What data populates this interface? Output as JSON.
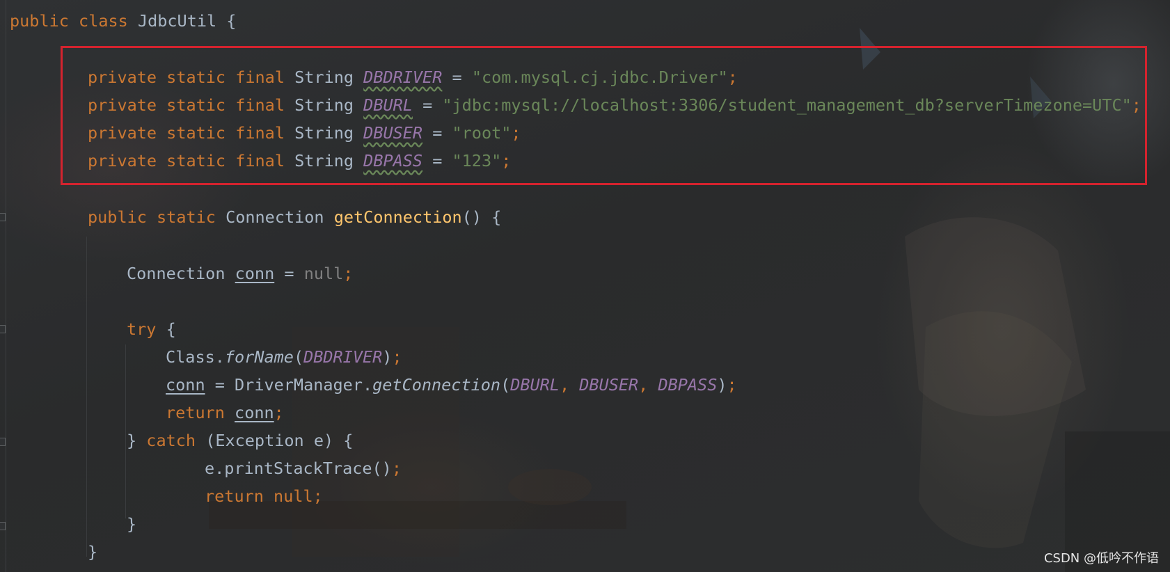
{
  "code": {
    "class_decl": {
      "kw_public": "public",
      "kw_class": "class",
      "name": "JdbcUtil",
      "brace": " {"
    },
    "fields": [
      {
        "mods": "private static final",
        "type": "String",
        "name": "DBDRIVER",
        "eq": " = ",
        "value": "\"com.mysql.cj.jdbc.Driver\"",
        "semi": ";"
      },
      {
        "mods": "private static final",
        "type": "String",
        "name": "DBURL",
        "eq": " = ",
        "value": "\"jdbc:mysql://localhost:3306/student_management_db?serverTimezone=UTC\"",
        "semi": ";"
      },
      {
        "mods": "private static final",
        "type": "String",
        "name": "DBUSER",
        "eq": " = ",
        "value": "\"root\"",
        "semi": ";"
      },
      {
        "mods": "private static final",
        "type": "String",
        "name": "DBPASS",
        "eq": " = ",
        "value": "\"123\"",
        "semi": ";"
      }
    ],
    "method_decl": {
      "mods": "public static",
      "type": "Connection",
      "name": "getConnection",
      "rest": "() {"
    },
    "conn_decl": {
      "type": "Connection",
      "var": "conn",
      "eq": " = ",
      "val": "null",
      "semi": ";"
    },
    "try_line": {
      "kw": "try",
      "rest": " {"
    },
    "forname_line": {
      "cls": "Class.",
      "method": "forName",
      "open": "(",
      "arg": "DBDRIVER",
      "close": ")",
      "semi": ";"
    },
    "getconn_line": {
      "var": "conn",
      "eq": " = DriverManager.",
      "method": "getConnection",
      "open": "(",
      "a1": "DBURL",
      "c1": ", ",
      "a2": "DBUSER",
      "c2": ", ",
      "a3": "DBPASS",
      "close": ")",
      "semi": ";"
    },
    "return_conn": {
      "kw": "return",
      "var": "conn",
      "semi": ";"
    },
    "catch_line": {
      "brace": "} ",
      "kw": "catch",
      "rest": " (Exception e) {"
    },
    "print_line": {
      "text": "e.printStackTrace()",
      "semi": ";"
    },
    "return_null": {
      "kw": "return",
      "val": "null",
      "semi": ";"
    },
    "close_inner": "}",
    "close_method": "}"
  },
  "watermark": "CSDN @低吟不作语",
  "colors": {
    "keyword": "#cc7832",
    "string": "#6a8759",
    "field": "#9876aa",
    "function": "#ffc66d",
    "highlight": "#d4232e"
  }
}
